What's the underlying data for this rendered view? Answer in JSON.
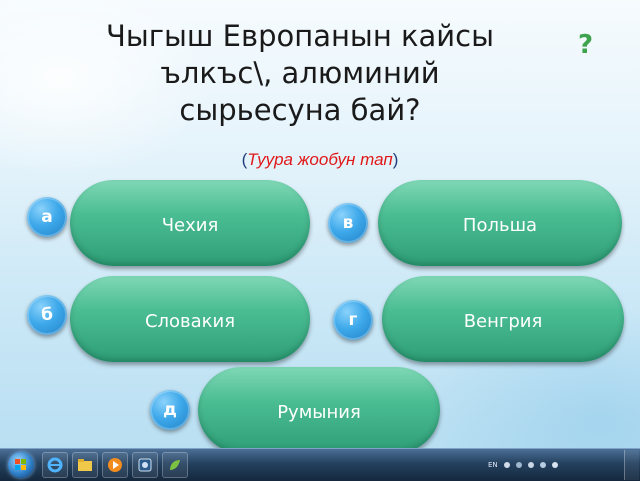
{
  "question": {
    "line1": "Чыгыш Европанын кайсы",
    "line2": "ълкъс\\, алюминий",
    "line3": "сырьесуна бай?",
    "qmark": "?"
  },
  "hint": {
    "open": "(",
    "text": "Туура жообун тап",
    "close": ")"
  },
  "answers": [
    {
      "letter": "а",
      "label": "Чехия"
    },
    {
      "letter": "в",
      "label": "Польша"
    },
    {
      "letter": "б",
      "label": "Словакия"
    },
    {
      "letter": "г",
      "label": "Венгрия"
    },
    {
      "letter": "д",
      "label": "Румыния"
    }
  ],
  "colors": {
    "answer_green": "#4bbd93",
    "badge_blue": "#3da8ea",
    "hint_red": "#e01818",
    "qmark_green": "#3fa34d"
  },
  "taskbar": {
    "icons": [
      "windows-start-icon",
      "internet-explorer-icon",
      "folder-icon",
      "media-player-icon",
      "app-icon",
      "green-app-icon"
    ],
    "tray_lang": "EN"
  }
}
